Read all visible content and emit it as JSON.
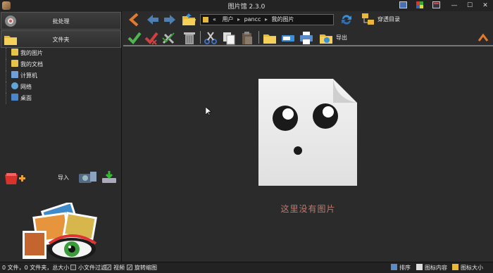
{
  "window": {
    "title": "图片馆 2.3.0"
  },
  "sidebar": {
    "batch_label": "批处理",
    "folder_label": "文件夹",
    "tree": [
      {
        "label": "我的图片",
        "icon": "pictures-folder-icon",
        "color": "#e6c34a"
      },
      {
        "label": "我的文档",
        "icon": "documents-folder-icon",
        "color": "#e6c34a"
      },
      {
        "label": "计算机",
        "icon": "computer-icon",
        "color": "#6f9fd8"
      },
      {
        "label": "网络",
        "icon": "network-icon",
        "color": "#5fa6d6"
      },
      {
        "label": "桌面",
        "icon": "desktop-icon",
        "color": "#4a86c8"
      }
    ],
    "import_label": "导入"
  },
  "navigation": {
    "path": [
      "«",
      "用户",
      "pancc",
      "我的图片"
    ],
    "through_dir_label": "穿透目录"
  },
  "toolbar": {
    "export_label": "导出"
  },
  "main": {
    "empty_message": "这里没有图片"
  },
  "status": {
    "summary": "0 文件，0 文件夹，总大小 0",
    "small_file_filter": "小文件过滤",
    "video": "视频",
    "rotate_thumbnail": "旋转缩图",
    "sort": "排序",
    "icon_content": "图标内容",
    "icon_size": "图标大小"
  },
  "colors": {
    "accent_orange": "#e27a2b",
    "empty_text": "#c07a6e",
    "background": "#2b2b2b"
  }
}
